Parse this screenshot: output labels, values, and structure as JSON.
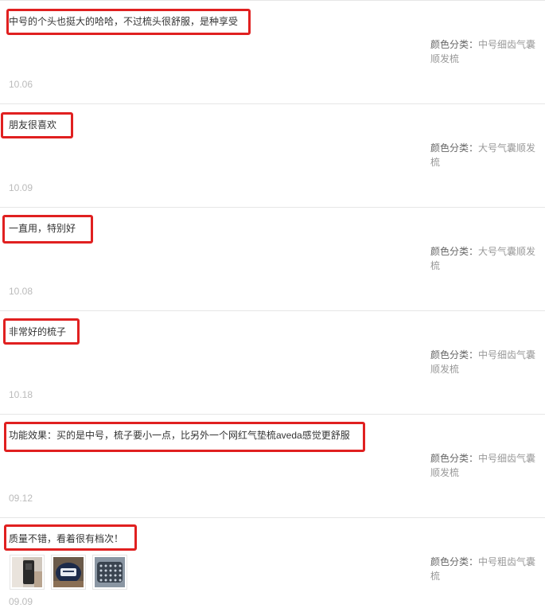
{
  "sku_label": "颜色分类：",
  "reviews": [
    {
      "text": "中号的个头也挺大的哈哈，不过梳头很舒服，是种享受",
      "sku": "中号细齿气囊顺发梳",
      "date": "10.06"
    },
    {
      "text": "朋友很喜欢",
      "sku": "大号气囊顺发梳",
      "date": "10.09"
    },
    {
      "text": "一直用，特别好",
      "sku": "大号气囊顺发梳",
      "date": "10.08"
    },
    {
      "text": "非常好的梳子",
      "sku": "中号细齿气囊顺发梳",
      "date": "10.18"
    },
    {
      "text": "功能效果：买的是中号，梳子要小一点，比另外一个网红气垫梳aveda感觉更舒服",
      "sku": "中号细齿气囊顺发梳",
      "date": "09.12"
    },
    {
      "text": "质量不错，看着很有档次！",
      "sku": "中号粗齿气囊梳",
      "date": "09.09"
    }
  ],
  "colors": {
    "highlight": "#e02020",
    "text": "#333333",
    "muted": "#999999",
    "date": "#bbbbbb",
    "divider": "#e6e6e6"
  }
}
